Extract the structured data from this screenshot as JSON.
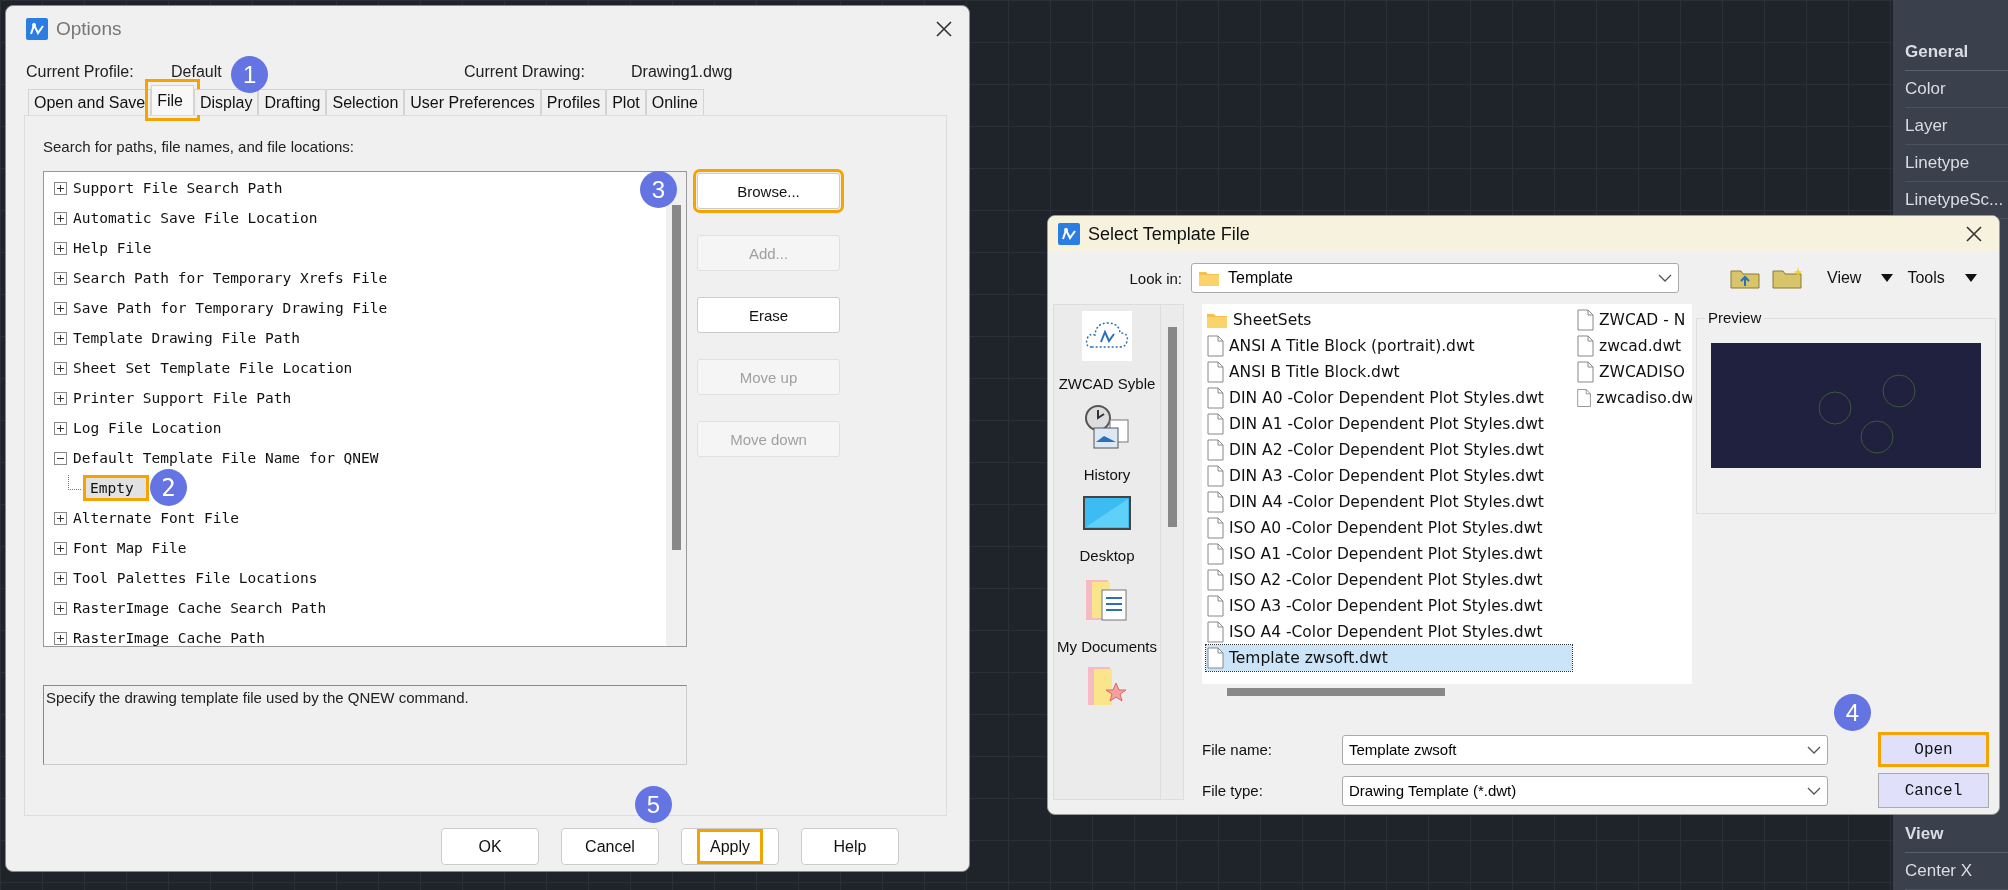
{
  "options_dialog": {
    "title": "Options",
    "profile_label": "Current Profile:",
    "profile_value": "Default",
    "drawing_label": "Current Drawing:",
    "drawing_value": "Drawing1.dwg",
    "tabs": [
      {
        "label": "Open and Save",
        "selected": false,
        "highlighted": false
      },
      {
        "label": "File",
        "selected": true,
        "highlighted": true,
        "callout": "1"
      },
      {
        "label": "Display",
        "selected": false,
        "highlighted": false
      },
      {
        "label": "Drafting",
        "selected": false,
        "highlighted": false
      },
      {
        "label": "Selection",
        "selected": false,
        "highlighted": false
      },
      {
        "label": "User Preferences",
        "selected": false,
        "highlighted": false
      },
      {
        "label": "Profiles",
        "selected": false,
        "highlighted": false
      },
      {
        "label": "Plot",
        "selected": false,
        "highlighted": false
      },
      {
        "label": "Online",
        "selected": false,
        "highlighted": false
      }
    ],
    "instruction": "Search for paths, file names, and file locations:",
    "tree": [
      {
        "label": "Support File Search Path",
        "expanded": false
      },
      {
        "label": "Automatic Save File Location",
        "expanded": false
      },
      {
        "label": "Help File",
        "expanded": false
      },
      {
        "label": "Search Path for Temporary Xrefs File",
        "expanded": false
      },
      {
        "label": "Save Path for Temporary Drawing File",
        "expanded": false
      },
      {
        "label": "Template Drawing File Path",
        "expanded": false
      },
      {
        "label": "Sheet Set Template File Location",
        "expanded": false
      },
      {
        "label": "Printer Support File Path",
        "expanded": false
      },
      {
        "label": "Log File Location",
        "expanded": false
      },
      {
        "label": "Default Template File Name for QNEW",
        "expanded": true,
        "children": [
          {
            "label": "Empty",
            "selected": true,
            "highlighted": true,
            "callout": "2"
          }
        ]
      },
      {
        "label": "Alternate Font File",
        "expanded": false
      },
      {
        "label": "Font Map File",
        "expanded": false
      },
      {
        "label": "Tool Palettes File Locations",
        "expanded": false
      },
      {
        "label": "RasterImage Cache Search Path",
        "expanded": false
      },
      {
        "label": "RasterImage Cache Path",
        "expanded": false
      }
    ],
    "side_buttons": [
      {
        "label": "Browse...",
        "disabled": false,
        "highlighted": true,
        "callout": "3"
      },
      {
        "label": "Add...",
        "disabled": true,
        "highlighted": false
      },
      {
        "label": "Erase",
        "disabled": false,
        "highlighted": false
      },
      {
        "label": "Move up",
        "disabled": true,
        "highlighted": false
      },
      {
        "label": "Move down",
        "disabled": true,
        "highlighted": false
      }
    ],
    "description": "Specify the drawing template file used by the QNEW command.",
    "buttons": [
      {
        "label": "OK",
        "highlighted": false
      },
      {
        "label": "Cancel",
        "highlighted": false
      },
      {
        "label": "Apply",
        "highlighted": true,
        "callout": "5"
      },
      {
        "label": "Help",
        "highlighted": false
      }
    ]
  },
  "template_dialog": {
    "title": "Select Template File",
    "look_in_label": "Look in:",
    "look_in_value": "Template",
    "view_menu": "View",
    "tools_menu": "Tools",
    "places": [
      {
        "label": "ZWCAD Syble",
        "kind": "cloud"
      },
      {
        "label": "History",
        "kind": "history"
      },
      {
        "label": "Desktop",
        "kind": "desktop"
      },
      {
        "label": "My Documents",
        "kind": "documents"
      },
      {
        "kind": "favorites"
      }
    ],
    "files": [
      {
        "name": "SheetSets",
        "kind": "folder",
        "selected": false
      },
      {
        "name": "ANSI A Title Block (portrait).dwt",
        "kind": "file",
        "selected": false
      },
      {
        "name": "ANSI B Title Block.dwt",
        "kind": "file",
        "selected": false
      },
      {
        "name": "DIN A0 -Color Dependent Plot Styles.dwt",
        "kind": "file",
        "selected": false
      },
      {
        "name": "DIN A1 -Color Dependent Plot Styles.dwt",
        "kind": "file",
        "selected": false
      },
      {
        "name": "DIN A2 -Color Dependent Plot Styles.dwt",
        "kind": "file",
        "selected": false
      },
      {
        "name": "DIN A3 -Color Dependent Plot Styles.dwt",
        "kind": "file",
        "selected": false
      },
      {
        "name": "DIN A4 -Color Dependent Plot Styles.dwt",
        "kind": "file",
        "selected": false
      },
      {
        "name": "ISO A0 -Color Dependent Plot Styles.dwt",
        "kind": "file",
        "selected": false
      },
      {
        "name": "ISO A1 -Color Dependent Plot Styles.dwt",
        "kind": "file",
        "selected": false
      },
      {
        "name": "ISO A2 -Color Dependent Plot Styles.dwt",
        "kind": "file",
        "selected": false
      },
      {
        "name": "ISO A3 -Color Dependent Plot Styles.dwt",
        "kind": "file",
        "selected": false
      },
      {
        "name": "ISO A4 -Color Dependent Plot Styles.dwt",
        "kind": "file",
        "selected": false
      },
      {
        "name": "Template zwsoft.dwt",
        "kind": "file",
        "selected": true
      },
      {
        "name": "ZWCAD - N",
        "kind": "file",
        "selected": false
      },
      {
        "name": "zwcad.dwt",
        "kind": "file",
        "selected": false
      },
      {
        "name": "ZWCADISO",
        "kind": "file",
        "selected": false
      },
      {
        "name": "zwcadiso.dw",
        "kind": "file",
        "selected": false
      }
    ],
    "preview_label": "Preview",
    "file_name_label": "File name:",
    "file_name_value": "Template zwsoft",
    "file_type_label": "File type:",
    "file_type_value": "Drawing Template (*.dwt)",
    "buttons": [
      {
        "label": "Open",
        "highlighted": true,
        "callout": "4"
      },
      {
        "label": "Cancel",
        "highlighted": false
      }
    ]
  },
  "properties_panel": {
    "groups": [
      {
        "title": "General",
        "rows": [
          "Color",
          "Layer",
          "Linetype",
          "LinetypeSc..."
        ]
      },
      {
        "title": "View",
        "rows": [
          "Center X"
        ]
      }
    ]
  }
}
